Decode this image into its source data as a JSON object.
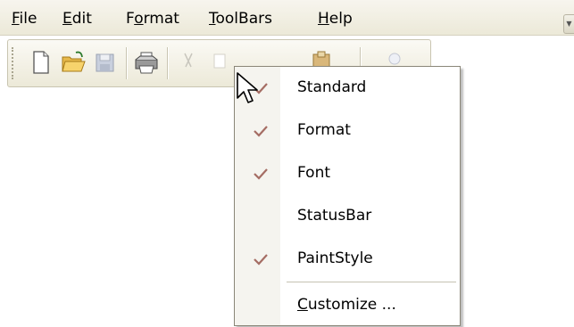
{
  "menubar": {
    "items": [
      {
        "label_acc": "F",
        "label_rest": "ile"
      },
      {
        "label_acc": "E",
        "label_rest": "dit"
      },
      {
        "label_pre": "F",
        "label_acc": "o",
        "label_rest": "rmat"
      },
      {
        "label_acc": "T",
        "label_rest": "oolBars"
      },
      {
        "label_acc": "H",
        "label_rest": "elp"
      }
    ],
    "dropdown_glyph": "▼"
  },
  "toolbar": {
    "buttons": [
      "new-document-icon",
      "open-folder-icon",
      "save-disk-icon",
      "print-icon",
      "cut-icon",
      "copy-icon",
      "paste-icon",
      "find-icon"
    ]
  },
  "popup": {
    "items": [
      {
        "label": "Standard",
        "checked": true
      },
      {
        "label": "Format",
        "checked": true
      },
      {
        "label": "Font",
        "checked": true
      },
      {
        "label": "StatusBar",
        "checked": false
      },
      {
        "label": "PaintStyle",
        "checked": true
      }
    ],
    "customize": {
      "acc": "C",
      "rest": "ustomize ..."
    }
  },
  "colors": {
    "menubar_bg": "#ece9d8",
    "check": "#a56d64",
    "popup_border": "#8a8678"
  }
}
